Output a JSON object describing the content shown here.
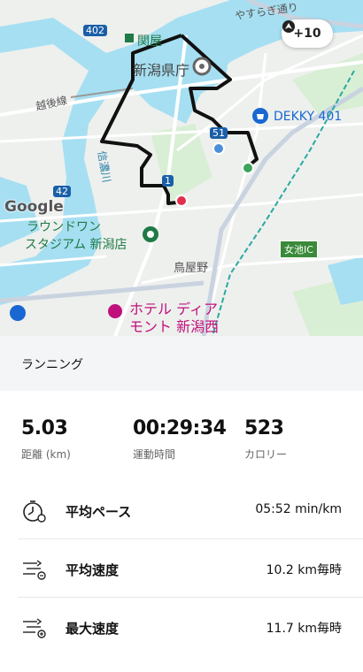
{
  "map": {
    "labels": {
      "sekiya": "関屋",
      "niigata_pref": "新潟県庁",
      "dekky": "DEKKY 401",
      "echigo_line": "越後線",
      "shinano_river": "信濃川",
      "round1_line1": "ラウンドワン",
      "round1_line2": "スタジアム 新潟店",
      "toriyano": "鳥屋野",
      "hotel_line1": "ホテル ディア",
      "hotel_line2": "モント 新潟西",
      "yasuragi": "やすらぎ通り",
      "route_402": "402",
      "route_51": "51",
      "route_42": "42",
      "route_1": "1",
      "ic": "女池IC",
      "google": "Google"
    },
    "badge": {
      "label": "+10",
      "icon": "compass-arrow-icon"
    },
    "colors": {
      "route": "#111111",
      "water": "#a6dff2",
      "start_pin": "#e1304c",
      "end_pin": "#3aa55b",
      "mid_pin": "#4a90d9"
    }
  },
  "activity": {
    "type": "ランニング"
  },
  "stats": [
    {
      "value": "5.03",
      "label": "距離 (km)"
    },
    {
      "value": "00:29:34",
      "label": "運動時間"
    },
    {
      "value": "523",
      "label": "カロリー"
    }
  ],
  "metrics": [
    {
      "name": "平均ペース",
      "value": "05:52 min/km",
      "icon": "stopwatch-icon"
    },
    {
      "name": "平均速度",
      "value": "10.2 km毎時",
      "icon": "speed-average-icon"
    },
    {
      "name": "最大速度",
      "value": "11.7 km毎時",
      "icon": "speed-max-icon"
    }
  ]
}
